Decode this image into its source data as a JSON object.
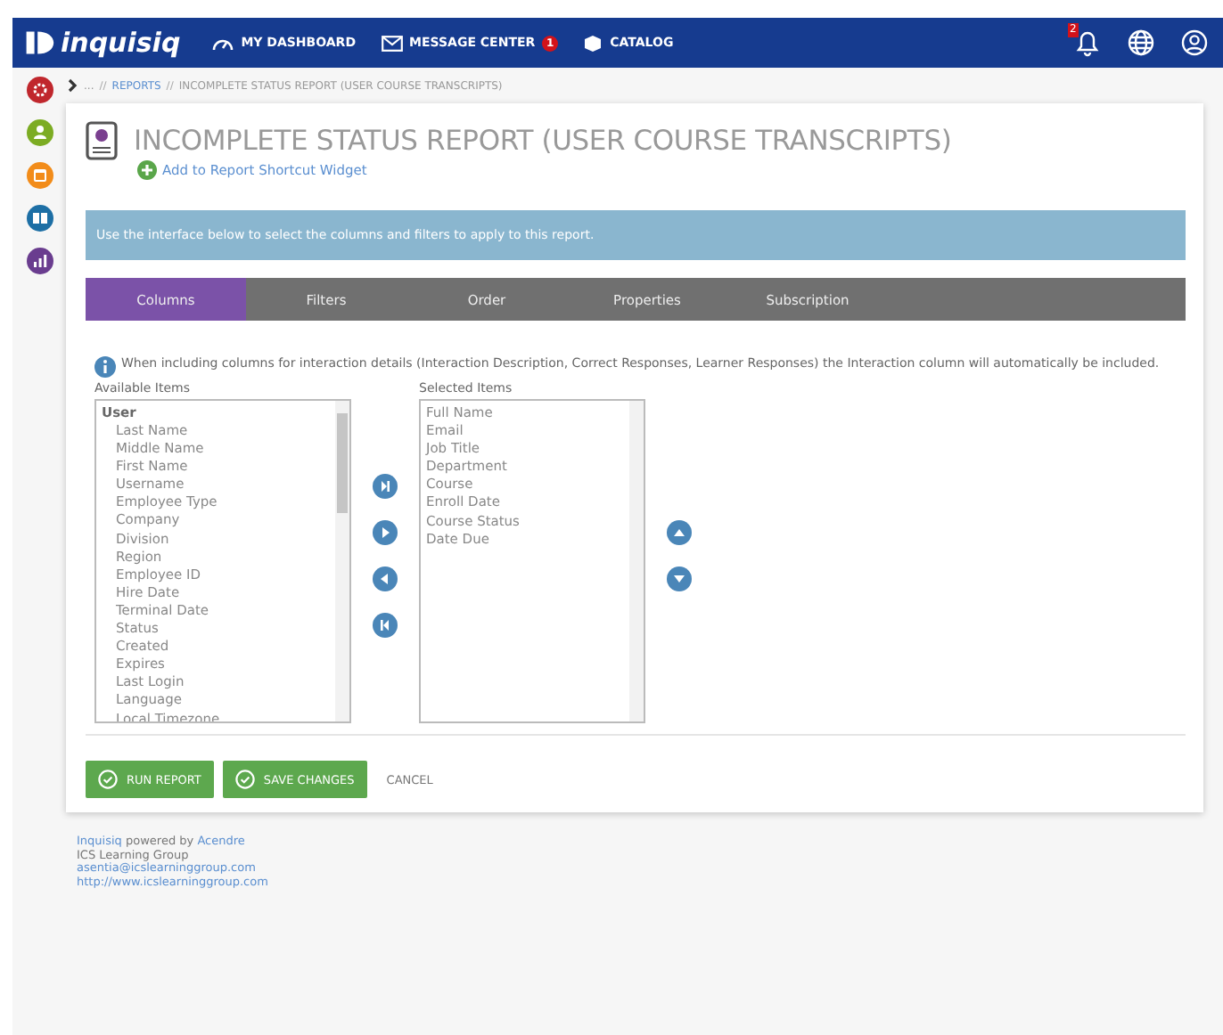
{
  "nav": {
    "logo": "inquisiq",
    "items": [
      {
        "kind": "dashboard",
        "label": "MY DASHBOARD"
      },
      {
        "kind": "message",
        "label": "MESSAGE CENTER",
        "badge": "1"
      },
      {
        "kind": "catalog",
        "label": "CATALOG"
      }
    ],
    "notification_badge": "2"
  },
  "sidebar": [
    {
      "kind": "gear",
      "color": "#c0272d"
    },
    {
      "kind": "users",
      "color": "#7cac23"
    },
    {
      "kind": "window",
      "color": "#f28c1a"
    },
    {
      "kind": "book",
      "color": "#1d6fa5"
    },
    {
      "kind": "chart",
      "color": "#6a3d8f"
    }
  ],
  "breadcrumb": {
    "ellipsis": "...",
    "separator": "//",
    "link": "REPORTS",
    "separator_2": "//",
    "current": "INCOMPLETE STATUS REPORT (USER COURSE TRANSCRIPTS)"
  },
  "title": "INCOMPLETE STATUS REPORT (USER COURSE TRANSCRIPTS)",
  "shortcut_link": "Add to Report Shortcut Widget",
  "info_banner": "Use the interface below to select the columns and filters to apply to this report.",
  "tabs": [
    {
      "label": "Columns",
      "selected": true
    },
    {
      "label": "Filters",
      "selected": false
    },
    {
      "label": "Order",
      "selected": false
    },
    {
      "label": "Properties",
      "selected": false
    },
    {
      "label": "Subscription",
      "selected": false
    }
  ],
  "note": "When including columns for interaction details (Interaction Description, Correct Responses, Learner Responses) the Interaction column will automatically be included.",
  "available": {
    "label": "Available Items",
    "group": "User",
    "items": [
      "Last Name",
      "Middle Name",
      "First Name",
      "Username",
      "Employee Type",
      "Company",
      "Division",
      "Region",
      "Employee ID",
      "Hire Date",
      "Terminal Date",
      "Status",
      "Created",
      "Expires",
      "Last Login",
      "Language",
      "Local Timezone"
    ]
  },
  "selected": {
    "label": "Selected Items",
    "items": [
      "Full Name",
      "Email",
      "Job Title",
      "Department",
      "Course",
      "Enroll Date",
      "Course Status",
      "Date Due"
    ]
  },
  "buttons": [
    {
      "kind": "run",
      "label": "RUN REPORT"
    },
    {
      "kind": "save",
      "label": "SAVE CHANGES"
    },
    {
      "kind": "cancel",
      "label": "CANCEL"
    }
  ],
  "footer": {
    "product": "Inquisiq",
    "powered": "powered by",
    "vendor": "Acendre",
    "org": "ICS Learning Group",
    "email": "asentia@icslearninggroup.com",
    "url": "http://www.icslearninggroup.com"
  }
}
